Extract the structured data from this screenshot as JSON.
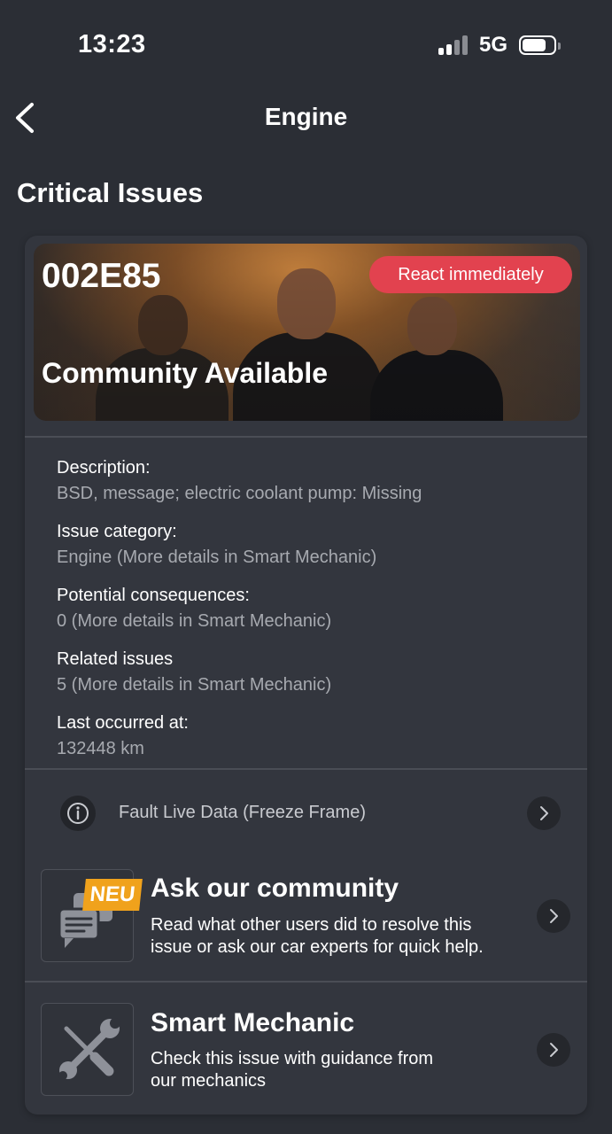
{
  "status_bar": {
    "time": "13:23",
    "network": "5G"
  },
  "nav": {
    "title": "Engine"
  },
  "section": {
    "title": "Critical Issues"
  },
  "issue": {
    "code": "002E85",
    "badge": "React immediately",
    "hero_subtitle": "Community Available",
    "details": [
      {
        "label": "Description:",
        "value": "BSD, message; electric coolant pump: Missing"
      },
      {
        "label": "Issue category:",
        "value": "Engine (More details in Smart Mechanic)"
      },
      {
        "label": "Potential consequences:",
        "value": "0 (More details in Smart Mechanic)"
      },
      {
        "label": "Related issues",
        "value": "5 (More details in Smart Mechanic)"
      },
      {
        "label": "Last occurred at:",
        "value": "132448 km"
      }
    ],
    "freeze_frame_label": "Fault Live Data (Freeze Frame)"
  },
  "community": {
    "badge": "NEU",
    "title": "Ask our community",
    "desc_line1": "Read what other users did to resolve this",
    "desc_line2": "issue or ask our car experts for quick help."
  },
  "mechanic": {
    "title": "Smart Mechanic",
    "desc_line1": "Check this issue with guidance from",
    "desc_line2": "our mechanics"
  },
  "colors": {
    "background": "#2b2e35",
    "card": "#33363e",
    "badge_red": "#e2424f",
    "neu_orange": "#f0a21c",
    "muted_text": "#a7aab0"
  },
  "icons": [
    "back-chevron-icon",
    "signal-icon",
    "battery-icon",
    "info-icon",
    "chevron-right-icon",
    "chat-bubbles-icon",
    "wrench-screwdriver-icon"
  ]
}
